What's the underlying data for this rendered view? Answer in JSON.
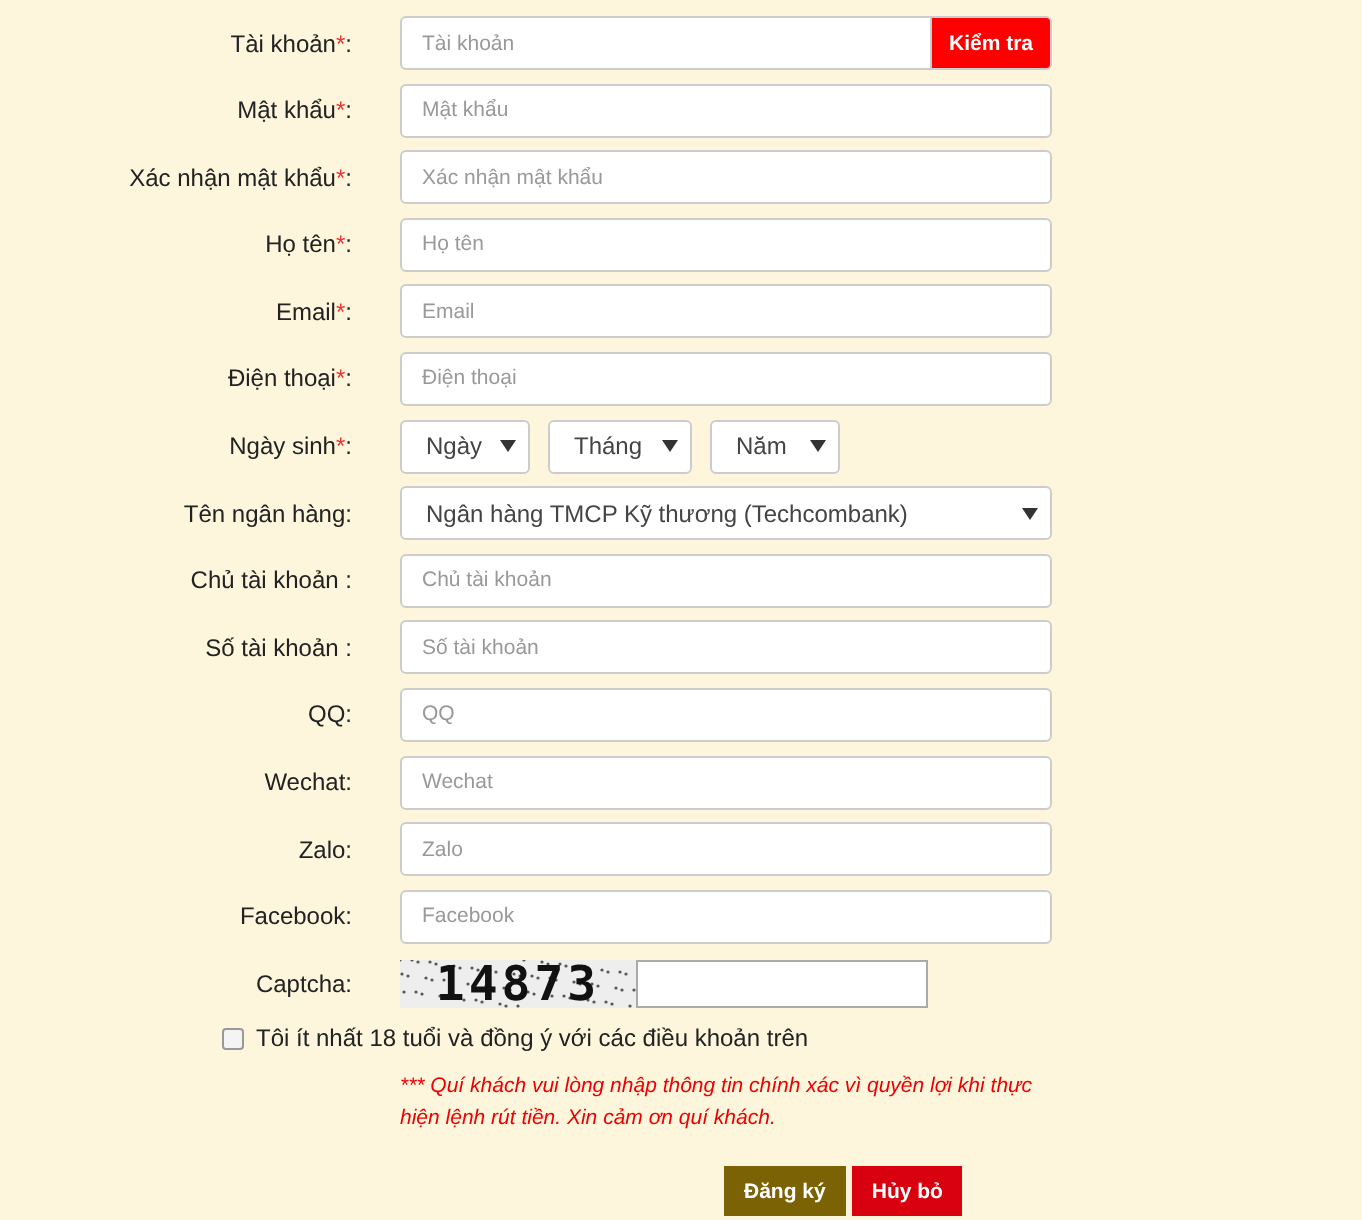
{
  "form": {
    "fields": [
      {
        "kind": "text",
        "label": "Tài khoản",
        "asterisk": "*",
        "colon": ":",
        "placeholder": "Tài khoản",
        "button": "Kiểm tra"
      },
      {
        "kind": "text",
        "label": "Mật khẩu",
        "asterisk": "*",
        "colon": ":",
        "placeholder": "Mật khẩu"
      },
      {
        "kind": "text",
        "label": "Xác nhận mật khẩu",
        "asterisk": "*",
        "colon": ":",
        "placeholder": "Xác nhận mật khẩu"
      },
      {
        "kind": "text",
        "label": "Họ tên",
        "asterisk": "*",
        "colon": ":",
        "placeholder": "Họ tên"
      },
      {
        "kind": "text",
        "label": "Email",
        "asterisk": "*",
        "colon": ":",
        "placeholder": "Email"
      },
      {
        "kind": "text",
        "label": "Điện thoại",
        "asterisk": "*",
        "colon": ":",
        "placeholder": "Điện thoại"
      },
      {
        "kind": "date",
        "label": "Ngày sinh",
        "asterisk": "*",
        "colon": ":",
        "selects": [
          "Ngày",
          "Tháng",
          "Năm"
        ]
      },
      {
        "kind": "select",
        "label": "Tên ngân hàng",
        "colon": ":",
        "value": "Ngân hàng TMCP Kỹ thương (Techcombank)"
      },
      {
        "kind": "text",
        "label": "Chủ tài khoản",
        "colon": " :",
        "placeholder": "Chủ tài khoản"
      },
      {
        "kind": "text",
        "label": "Số tài khoản",
        "colon": " :",
        "placeholder": "Số tài khoản"
      },
      {
        "kind": "text",
        "label": "QQ",
        "colon": ":",
        "placeholder": "QQ"
      },
      {
        "kind": "text",
        "label": "Wechat",
        "colon": ":",
        "placeholder": "Wechat"
      },
      {
        "kind": "text",
        "label": "Zalo",
        "colon": ":",
        "placeholder": "Zalo"
      },
      {
        "kind": "text",
        "label": "Facebook",
        "colon": ":",
        "placeholder": "Facebook"
      },
      {
        "kind": "captcha",
        "label": "Captcha",
        "colon": ":",
        "code": "14873"
      }
    ],
    "agree": {
      "label": "Tôi ít nhất 18 tuổi và đồng ý với các điều khoản trên",
      "checked": false
    },
    "note": "*** Quí khách vui lòng nhập thông tin chính xác vì quyền lợi khi thực hiện lệnh rút tiền. Xin cảm ơn quí khách.",
    "buttons": [
      {
        "label": "Đăng ký",
        "kind": "submit"
      },
      {
        "label": "Hủy bỏ",
        "kind": "cancel"
      }
    ]
  }
}
